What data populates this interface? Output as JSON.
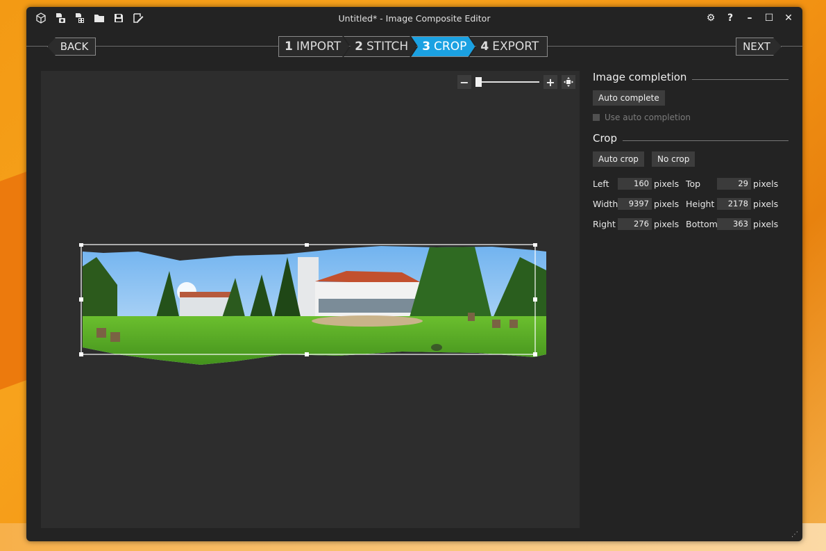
{
  "window": {
    "title": "Untitled* - Image Composite Editor"
  },
  "toolbar_icons": [
    "cube-icon",
    "new-panorama-icon",
    "new-video-icon",
    "open-folder-icon",
    "save-icon",
    "publish-icon"
  ],
  "window_controls": {
    "settings": "⚙",
    "help": "?",
    "minimize": "–",
    "maximize": "☐",
    "close": "✕"
  },
  "nav": {
    "back": "BACK",
    "next": "NEXT",
    "steps": [
      {
        "num": "1",
        "label": "IMPORT"
      },
      {
        "num": "2",
        "label": "STITCH"
      },
      {
        "num": "3",
        "label": "CROP"
      },
      {
        "num": "4",
        "label": "EXPORT"
      }
    ],
    "active_step": 3
  },
  "zoom": {
    "minus": "−",
    "plus": "+",
    "level": 0.0
  },
  "panel": {
    "image_completion": {
      "title": "Image completion",
      "auto_complete": "Auto complete",
      "use_auto_completion": "Use auto completion"
    },
    "crop": {
      "title": "Crop",
      "auto_crop": "Auto crop",
      "no_crop": "No crop",
      "fields": {
        "left_label": "Left",
        "left_value": "160",
        "top_label": "Top",
        "top_value": "29",
        "width_label": "Width",
        "width_value": "9397",
        "height_label": "Height",
        "height_value": "2178",
        "right_label": "Right",
        "right_value": "276",
        "bottom_label": "Bottom",
        "bottom_value": "363",
        "unit": "pixels"
      }
    }
  },
  "colors": {
    "accent": "#1ba1e2",
    "background": "#232323",
    "canvas": "#2d2d2d"
  }
}
